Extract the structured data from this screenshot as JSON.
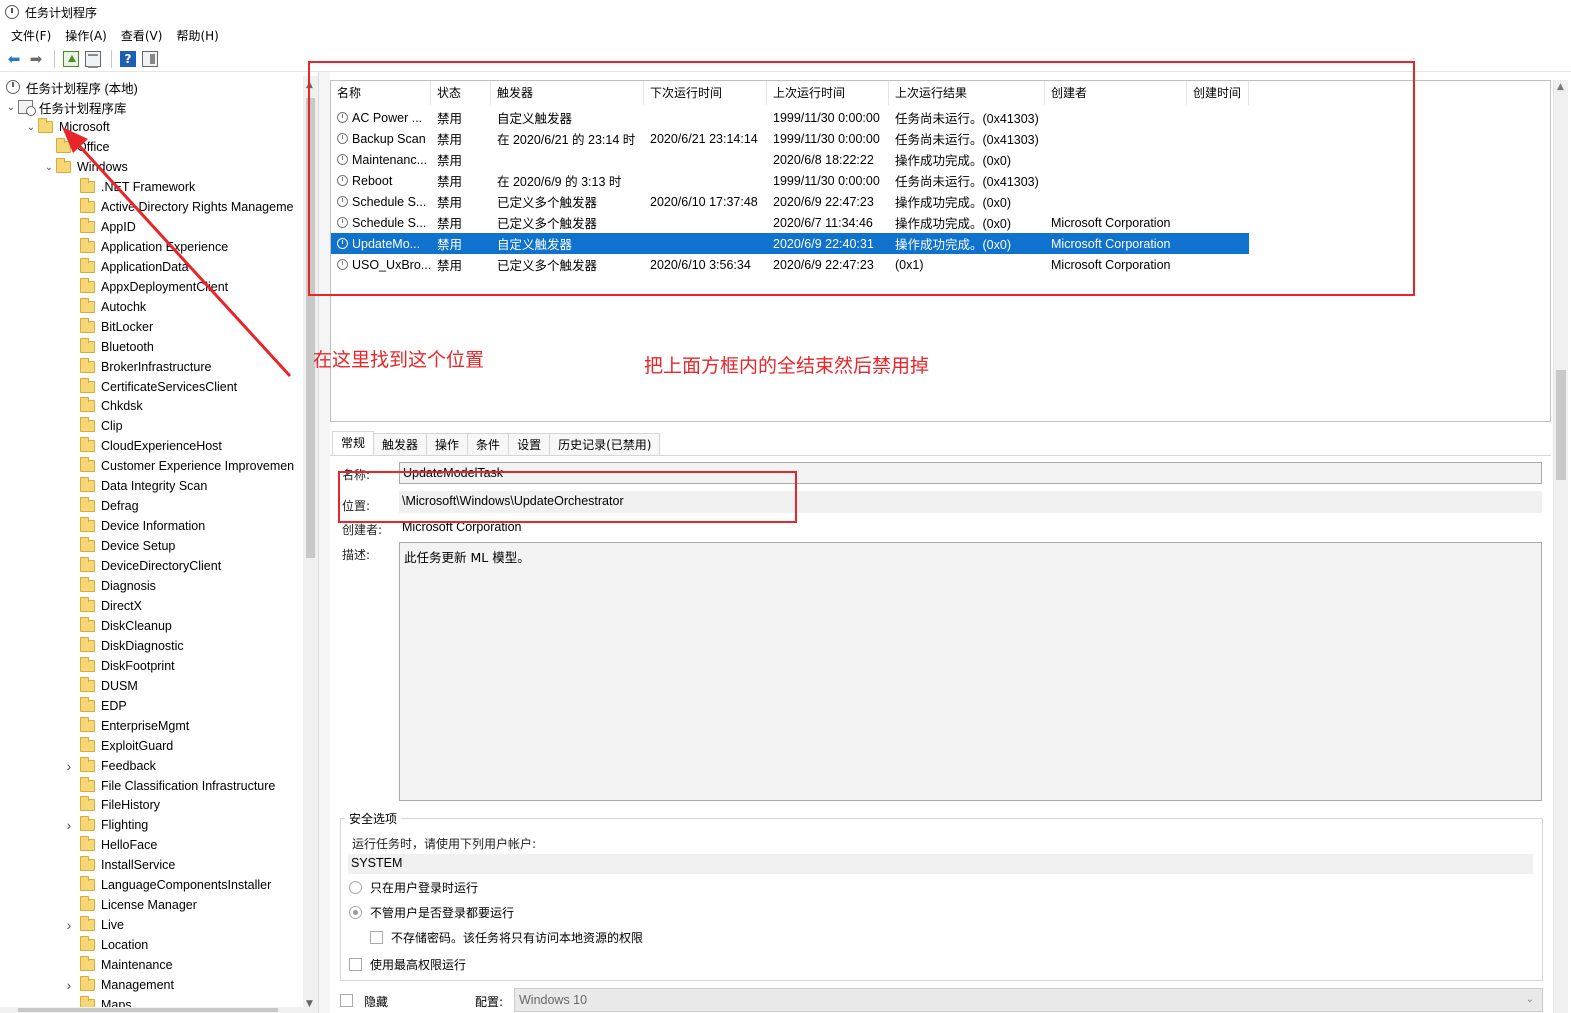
{
  "window": {
    "title": "任务计划程序"
  },
  "menu": [
    "文件(F)",
    "操作(A)",
    "查看(V)",
    "帮助(H)"
  ],
  "toolbar": {
    "buttons": [
      "back-icon",
      "forward-icon",
      "up-folder-icon",
      "show-hide-console-tree-icon",
      "help-icon",
      "show-hide-action-pane-icon"
    ]
  },
  "tree": {
    "root": "任务计划程序 (本地)",
    "library": "任务计划程序库",
    "microsoft": "Microsoft",
    "office": "Office",
    "windows": "Windows",
    "children": [
      ".NET Framework",
      "Active Directory Rights Manageme",
      "AppID",
      "Application Experience",
      "ApplicationData",
      "AppxDeploymentClient",
      "Autochk",
      "BitLocker",
      "Bluetooth",
      "BrokerInfrastructure",
      "CertificateServicesClient",
      "Chkdsk",
      "Clip",
      "CloudExperienceHost",
      "Customer Experience Improvemen",
      "Data Integrity Scan",
      "Defrag",
      "Device Information",
      "Device Setup",
      "DeviceDirectoryClient",
      "Diagnosis",
      "DirectX",
      "DiskCleanup",
      "DiskDiagnostic",
      "DiskFootprint",
      "DUSM",
      "EDP",
      "EnterpriseMgmt",
      "ExploitGuard",
      "Feedback",
      "File Classification Infrastructure",
      "FileHistory",
      "Flighting",
      "HelloFace",
      "InstallService",
      "LanguageComponentsInstaller",
      "License Manager",
      "Live",
      "Location",
      "Maintenance",
      "Management",
      "Maps"
    ],
    "expandable": [
      "Feedback",
      "Flighting",
      "Live",
      "Management"
    ]
  },
  "tasks": {
    "columns": [
      "名称",
      "状态",
      "触发器",
      "下次运行时间",
      "上次运行时间",
      "上次运行结果",
      "创建者",
      "创建时间"
    ],
    "rows": [
      [
        "AC Power ...",
        "禁用",
        "自定义触发器",
        "",
        "1999/11/30 0:00:00",
        "任务尚未运行。(0x41303)",
        "",
        ""
      ],
      [
        "Backup Scan",
        "禁用",
        "在 2020/6/21 的 23:14 时",
        "2020/6/21 23:14:14",
        "1999/11/30 0:00:00",
        "任务尚未运行。(0x41303)",
        "",
        ""
      ],
      [
        "Maintenanc...",
        "禁用",
        "",
        "",
        "2020/6/8 18:22:22",
        "操作成功完成。(0x0)",
        "",
        ""
      ],
      [
        "Reboot",
        "禁用",
        "在 2020/6/9 的 3:13 时",
        "",
        "1999/11/30 0:00:00",
        "任务尚未运行。(0x41303)",
        "",
        ""
      ],
      [
        "Schedule S...",
        "禁用",
        "已定义多个触发器",
        "2020/6/10 17:37:48",
        "2020/6/9 22:47:23",
        "操作成功完成。(0x0)",
        "",
        ""
      ],
      [
        "Schedule S...",
        "禁用",
        "已定义多个触发器",
        "",
        "2020/6/7 11:34:46",
        "操作成功完成。(0x0)",
        "Microsoft Corporation",
        ""
      ],
      [
        "UpdateMo...",
        "禁用",
        "自定义触发器",
        "",
        "2020/6/9 22:40:31",
        "操作成功完成。(0x0)",
        "Microsoft Corporation",
        ""
      ],
      [
        "USO_UxBro...",
        "禁用",
        "已定义多个触发器",
        "2020/6/10 3:56:34",
        "2020/6/9 22:47:23",
        "(0x1)",
        "Microsoft Corporation",
        ""
      ]
    ],
    "selected_index": 6
  },
  "tabs": [
    "常规",
    "触发器",
    "操作",
    "条件",
    "设置",
    "历史记录(已禁用)"
  ],
  "detail": {
    "name_label": "名称:",
    "name_value": "UpdateModelTask",
    "location_label": "位置:",
    "location_value": "\\Microsoft\\Windows\\UpdateOrchestrator",
    "author_label": "创建者:",
    "author_value": "Microsoft Corporation",
    "desc_label": "描述:",
    "desc_value": "此任务更新 ML 模型。",
    "security_title": "安全选项",
    "run_as_prompt": "运行任务时，请使用下列用户帐户:",
    "run_as_user": "SYSTEM",
    "opt_logged_on": "只在用户登录时运行",
    "opt_whether_logged": "不管用户是否登录都要运行",
    "opt_no_password": "不存储密码。该任务将只有访问本地资源的权限",
    "opt_highest": "使用最高权限运行",
    "hidden_label": "隐藏",
    "config_label": "配置:",
    "config_value": "Windows 10"
  },
  "annotations": {
    "find_here": "在这里找到这个位置",
    "disable_all": "把上面方框内的全结束然后禁用掉",
    "color": "#e8262a"
  },
  "colors": {
    "selection": "#0f72cf",
    "annotation": "#e8262a"
  }
}
